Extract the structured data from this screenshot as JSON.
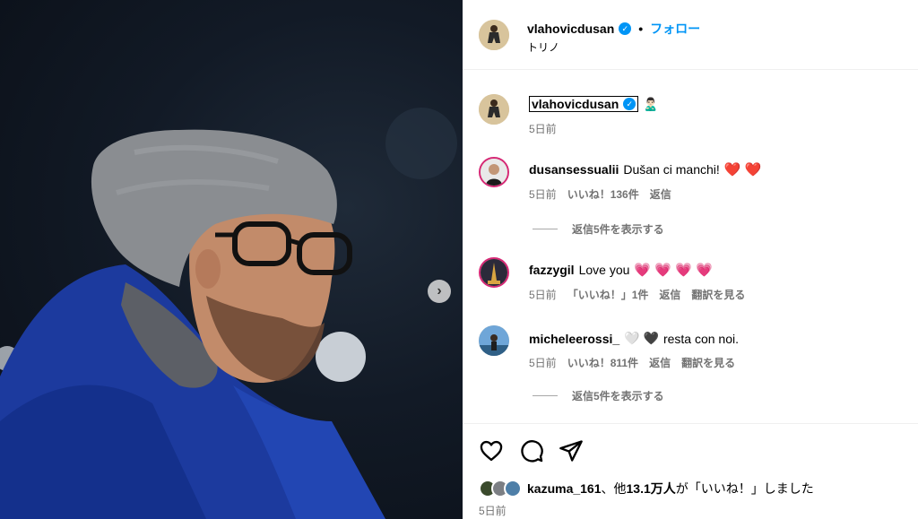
{
  "post": {
    "username": "vlahovicdusan",
    "follow_label": "フォロー",
    "location": "トリノ"
  },
  "caption": {
    "username": "vlahovicdusan",
    "emoji": "🙎🏻‍♂️",
    "time": "5日前"
  },
  "comments": [
    {
      "username": "dusansessualii",
      "text": "Dušan ci manchi!",
      "hearts": "❤️ ❤️",
      "time": "5日前",
      "likes": "いいね！136件",
      "reply_label": "返信",
      "view_replies": "返信5件を表示する"
    },
    {
      "username": "fazzygil",
      "text": "Love you",
      "hearts": "💗 💗 💗 💗",
      "time": "5日前",
      "likes": "「いいね！」1件",
      "reply_label": "返信",
      "translate_label": "翻訳を見る"
    },
    {
      "username": "micheleerossi_",
      "hearts_pre": "🤍 🖤",
      "text": "resta con noi.",
      "time": "5日前",
      "likes": "いいね！811件",
      "reply_label": "返信",
      "translate_label": "翻訳を見る",
      "view_replies": "返信5件を表示する"
    }
  ],
  "likes_summary": {
    "user": "kazuma_161",
    "mid": "、他",
    "count": "13.1万人",
    "suffix": "が「いいね！」しました"
  },
  "post_time": "5日前",
  "icons": {
    "like": "heart-icon",
    "comment": "comment-icon",
    "share": "share-icon",
    "next": "chevron-right-icon",
    "verified": "verified-badge-icon"
  },
  "colors": {
    "accent": "#0095f6",
    "heart": "#ff3b5c",
    "muted": "#737373"
  }
}
